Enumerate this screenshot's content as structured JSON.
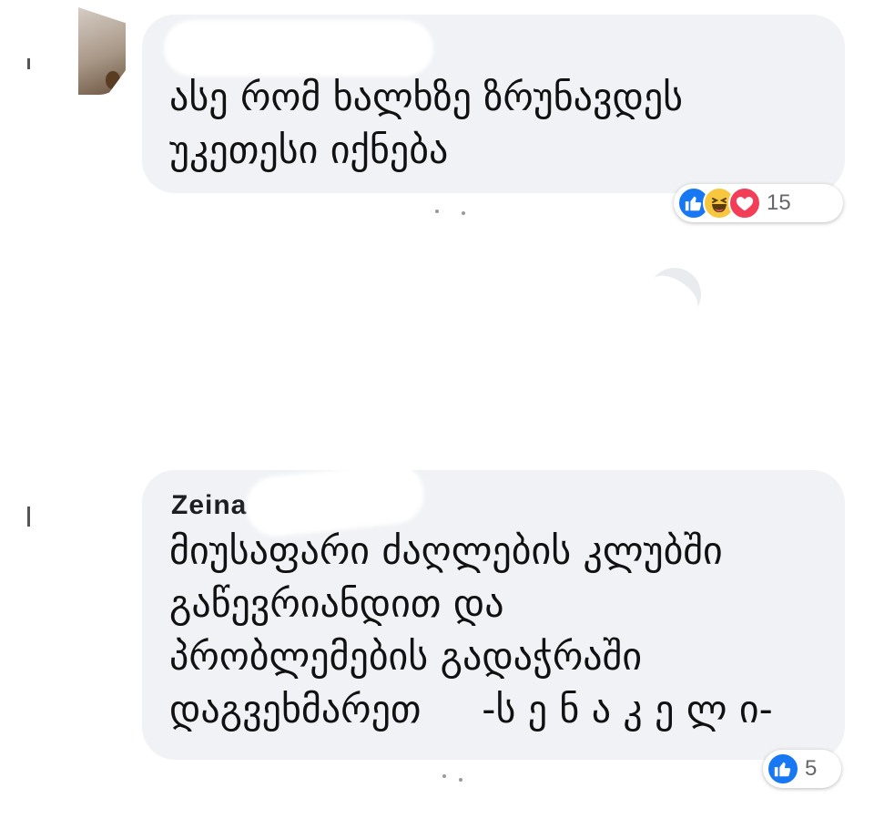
{
  "comments": [
    {
      "text_lines": [
        "ასე რომ ხალხზე ზრუნავდეს",
        "უკეთესი იქნება"
      ],
      "reactions": {
        "icons": [
          "like-icon",
          "haha-icon",
          "love-icon"
        ],
        "count": "15"
      }
    },
    {
      "author_partial": "Zeina",
      "text_lines": [
        "მიუსაფარი ძაღლების კლუბში",
        "გაწევრიანდით და",
        "პრობლემების გადაჭრაში",
        "დაგვეხმარეთ     -ს ე ნ ა კ ე ლ ი-"
      ],
      "reactions": {
        "icons": [
          "like-icon"
        ],
        "count": "5"
      }
    }
  ],
  "colors": {
    "bubble": "#f0f2f5",
    "like": "#1877f2",
    "haha": "#f7c83f",
    "love": "#f33e58",
    "count_text": "#65676b"
  }
}
